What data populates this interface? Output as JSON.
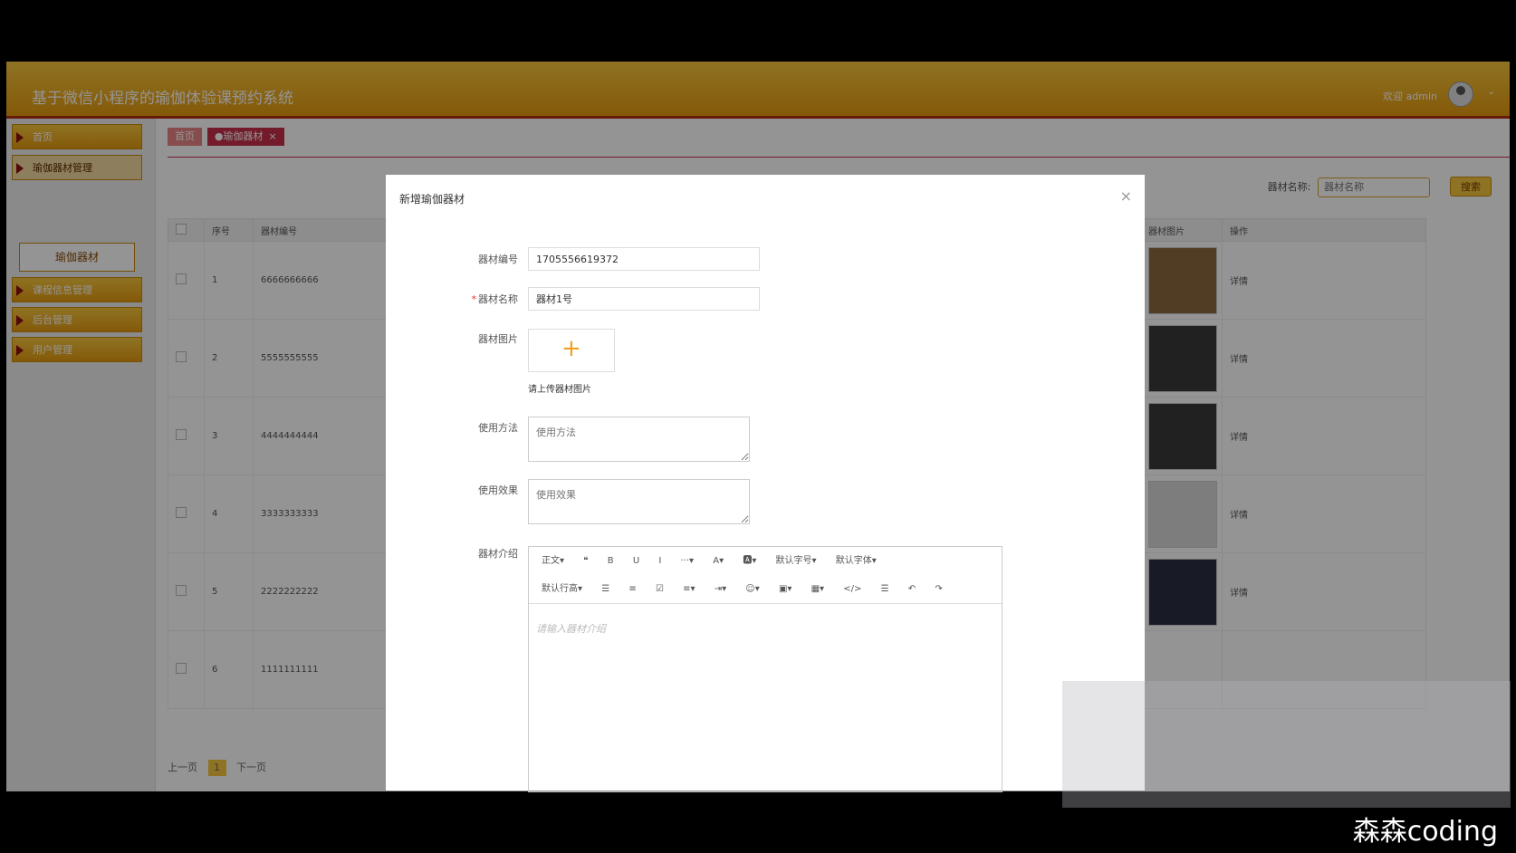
{
  "app": {
    "title": "基于微信小程序的瑜伽体验课预约系统",
    "welcome": "欢迎 admin"
  },
  "sidebar": {
    "items": [
      {
        "label": "首页"
      },
      {
        "label": "瑜伽器材管理"
      },
      {
        "label": "课程信息管理"
      },
      {
        "label": "后台管理"
      },
      {
        "label": "用户管理"
      }
    ],
    "submenu": "瑜伽器材"
  },
  "tabs": [
    {
      "label": "首页"
    },
    {
      "label": "●瑜伽器材",
      "close": "×"
    }
  ],
  "search": {
    "label": "器材名称:",
    "placeholder": "器材名称",
    "button": "搜索"
  },
  "table": {
    "headers": [
      "序号",
      "器材编号",
      "器材图片",
      "操作"
    ],
    "rows": [
      {
        "index": "1",
        "code": "6666666666",
        "action": "详情"
      },
      {
        "index": "2",
        "code": "5555555555",
        "action": "详情"
      },
      {
        "index": "3",
        "code": "4444444444",
        "action": "详情"
      },
      {
        "index": "4",
        "code": "3333333333",
        "action": "详情"
      },
      {
        "index": "5",
        "code": "2222222222",
        "action": "详情"
      },
      {
        "index": "6",
        "code": "1111111111",
        "action": ""
      }
    ]
  },
  "pager": {
    "prev": "上一页",
    "current": "1",
    "next": "下一页"
  },
  "modal": {
    "title": "新增瑜伽器材",
    "close": "×",
    "fields": {
      "code_label": "器材编号",
      "code_value": "1705556619372",
      "name_label": "器材名称",
      "name_required": "*",
      "name_value": "器材1号",
      "image_label": "器材图片",
      "upload_plus": "+",
      "upload_hint": "请上传器材图片",
      "usage_label": "使用方法",
      "usage_placeholder": "使用方法",
      "effect_label": "使用效果",
      "effect_placeholder": "使用效果",
      "intro_label": "器材介绍",
      "intro_placeholder": "请输入器材介绍"
    },
    "editor_toolbar": {
      "row1": [
        "正文▾",
        "❝",
        "B",
        "U",
        "I",
        "···▾",
        "A▾",
        "🅰▾",
        "默认字号▾",
        "默认字体▾"
      ],
      "row2": [
        "默认行高▾",
        "☰",
        "≡",
        "☑",
        "≡▾",
        "⇥▾",
        "☺▾",
        "▣▾",
        "▦▾",
        "</>",
        "☰",
        "↶",
        "↷"
      ]
    }
  },
  "footer": {
    "text": "森森coding"
  }
}
